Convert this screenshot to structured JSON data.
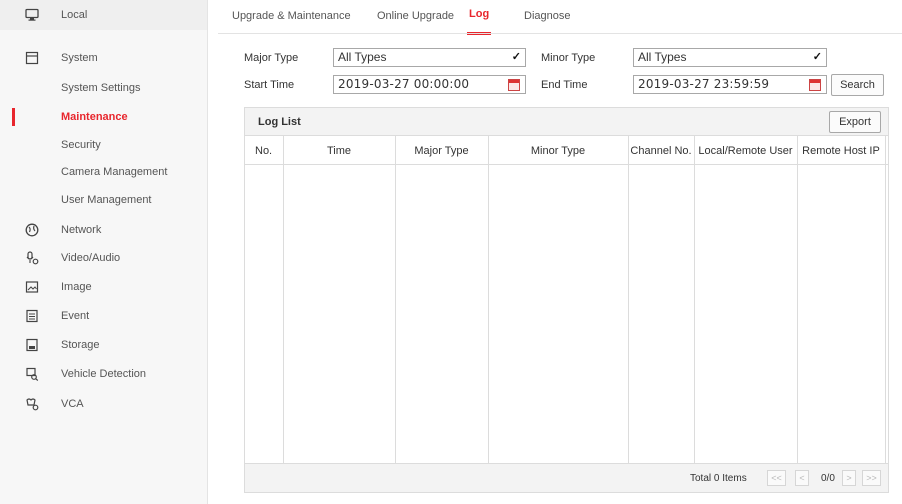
{
  "sidebar": {
    "items": [
      {
        "label": "Local",
        "icon": "monitor-icon"
      },
      {
        "label": "System",
        "icon": "system-icon"
      },
      {
        "label": "System Settings"
      },
      {
        "label": "Maintenance"
      },
      {
        "label": "Security"
      },
      {
        "label": "Camera Management"
      },
      {
        "label": "User Management"
      },
      {
        "label": "Network",
        "icon": "globe-icon"
      },
      {
        "label": "Video/Audio",
        "icon": "video-audio-icon"
      },
      {
        "label": "Image",
        "icon": "image-icon"
      },
      {
        "label": "Event",
        "icon": "event-icon"
      },
      {
        "label": "Storage",
        "icon": "storage-icon"
      },
      {
        "label": "Vehicle Detection",
        "icon": "vehicle-detection-icon"
      },
      {
        "label": "VCA",
        "icon": "vca-icon"
      }
    ],
    "active": "Maintenance"
  },
  "tabs": {
    "items": [
      "Upgrade & Maintenance",
      "Online Upgrade",
      "Log",
      "Diagnose"
    ],
    "active": "Log"
  },
  "filters": {
    "major_type_label": "Major Type",
    "major_type_value": "All Types",
    "minor_type_label": "Minor Type",
    "minor_type_value": "All Types",
    "start_time_label": "Start Time",
    "start_time_value": "2019-03-27 00:00:00",
    "end_time_label": "End Time",
    "end_time_value": "2019-03-27 23:59:59",
    "search_label": "Search"
  },
  "log_list": {
    "title": "Log List",
    "export_label": "Export",
    "columns": [
      "No.",
      "Time",
      "Major Type",
      "Minor Type",
      "Channel No.",
      "Local/Remote User",
      "Remote Host IP"
    ],
    "rows": []
  },
  "pagination": {
    "total": "Total 0 Items",
    "first": "<<",
    "prev": "<",
    "page": "0/0",
    "next": ">",
    "last": ">>"
  },
  "colors": {
    "accent": "#e8262d",
    "border": "#dcdcdc",
    "sidebar_bg": "#f7f7f7"
  }
}
